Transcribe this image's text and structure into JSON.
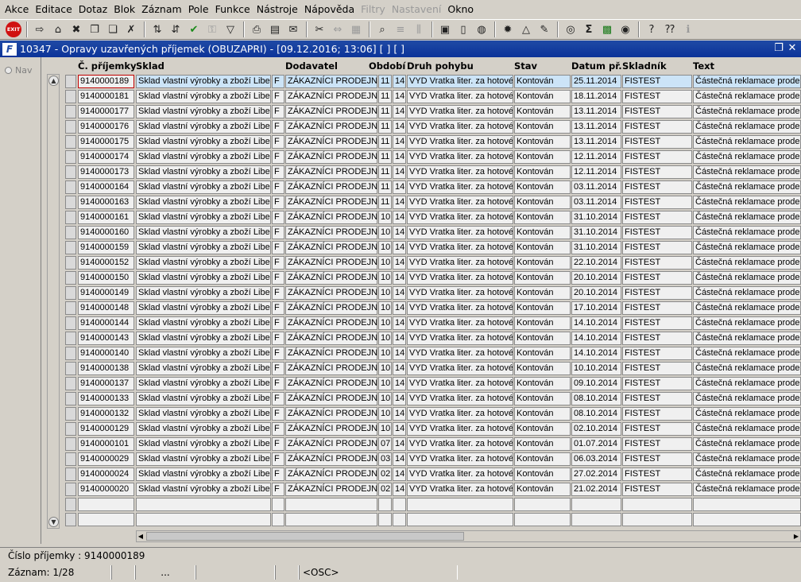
{
  "menu": [
    "Akce",
    "Editace",
    "Dotaz",
    "Blok",
    "Záznam",
    "Pole",
    "Funkce",
    "Nástroje",
    "Nápověda",
    "Filtry",
    "Nastavení",
    "Okno"
  ],
  "menu_disabled": [
    "Filtry",
    "Nastavení"
  ],
  "toolbar": {
    "exit_label": "EXIT",
    "icons": [
      "save-icon",
      "print-icon",
      "delete-icon",
      "copy-icon",
      "paste-icon",
      "clear-icon",
      "sort-asc-icon",
      "sort-desc-icon",
      "check-icon",
      "key-icon",
      "filter-icon",
      "printer-icon",
      "document-icon",
      "mail-icon",
      "cut-icon",
      "move-icon",
      "table-icon",
      "search-icon",
      "list-icon",
      "columns-icon",
      "report-icon",
      "page-icon",
      "globe-icon",
      "gear-icon",
      "triangle-icon",
      "edit-icon",
      "disk-icon",
      "sum-icon",
      "excel-icon",
      "web-icon",
      "help-icon",
      "whatsthis-icon",
      "info-icon"
    ]
  },
  "window": {
    "title": "10347 - Opravy uzavřených příjemek (OBUZAPRI) - [09.12.2016; 13:06] [ ] [ ]",
    "restore_glyph": "❐",
    "close_glyph": "✕"
  },
  "nav": {
    "label": "Nav"
  },
  "columns": {
    "cislo": "Č. příjemky",
    "sklad": "Sklad",
    "dodavatel": "Dodavatel",
    "obdobi": "Období",
    "druh": "Druh pohybu",
    "stav": "Stav",
    "datum": "Datum př.",
    "skladnik": "Skladník",
    "text": "Text"
  },
  "rows": [
    {
      "cislo": "9140000189",
      "sklad": "Sklad vlastní výrobky a zboží Liber",
      "f": "F",
      "dodavatel": "ZÁKAZNÍCI PRODEJNY",
      "o1": "11",
      "o2": "14",
      "druh": "VYD Vratka liter. za hotové",
      "stav": "Kontován",
      "datum": "25.11.2014",
      "skladnik": "FISTEST",
      "text": "Částečná reklamace prode"
    },
    {
      "cislo": "9140000181",
      "sklad": "Sklad vlastní výrobky a zboží Liber",
      "f": "F",
      "dodavatel": "ZÁKAZNÍCI PRODEJNY",
      "o1": "11",
      "o2": "14",
      "druh": "VYD Vratka liter. za hotové",
      "stav": "Kontován",
      "datum": "18.11.2014",
      "skladnik": "FISTEST",
      "text": "Částečná reklamace prode"
    },
    {
      "cislo": "9140000177",
      "sklad": "Sklad vlastní výrobky a zboží Liber",
      "f": "F",
      "dodavatel": "ZÁKAZNÍCI PRODEJNY",
      "o1": "11",
      "o2": "14",
      "druh": "VYD Vratka liter. za hotové",
      "stav": "Kontován",
      "datum": "13.11.2014",
      "skladnik": "FISTEST",
      "text": "Částečná reklamace prode"
    },
    {
      "cislo": "9140000176",
      "sklad": "Sklad vlastní výrobky a zboží Liber",
      "f": "F",
      "dodavatel": "ZÁKAZNÍCI PRODEJNY",
      "o1": "11",
      "o2": "14",
      "druh": "VYD Vratka liter. za hotové",
      "stav": "Kontován",
      "datum": "13.11.2014",
      "skladnik": "FISTEST",
      "text": "Částečná reklamace prode"
    },
    {
      "cislo": "9140000175",
      "sklad": "Sklad vlastní výrobky a zboží Liber",
      "f": "F",
      "dodavatel": "ZÁKAZNÍCI PRODEJNY",
      "o1": "11",
      "o2": "14",
      "druh": "VYD Vratka liter. za hotové",
      "stav": "Kontován",
      "datum": "13.11.2014",
      "skladnik": "FISTEST",
      "text": "Částečná reklamace prode"
    },
    {
      "cislo": "9140000174",
      "sklad": "Sklad vlastní výrobky a zboží Liber",
      "f": "F",
      "dodavatel": "ZÁKAZNÍCI PRODEJNY",
      "o1": "11",
      "o2": "14",
      "druh": "VYD Vratka liter. za hotové",
      "stav": "Kontován",
      "datum": "12.11.2014",
      "skladnik": "FISTEST",
      "text": "Částečná reklamace prode"
    },
    {
      "cislo": "9140000173",
      "sklad": "Sklad vlastní výrobky a zboží Liber",
      "f": "F",
      "dodavatel": "ZÁKAZNÍCI PRODEJNY",
      "o1": "11",
      "o2": "14",
      "druh": "VYD Vratka liter. za hotové",
      "stav": "Kontován",
      "datum": "12.11.2014",
      "skladnik": "FISTEST",
      "text": "Částečná reklamace prode"
    },
    {
      "cislo": "9140000164",
      "sklad": "Sklad vlastní výrobky a zboží Liber",
      "f": "F",
      "dodavatel": "ZÁKAZNÍCI PRODEJNY",
      "o1": "11",
      "o2": "14",
      "druh": "VYD Vratka liter. za hotové",
      "stav": "Kontován",
      "datum": "03.11.2014",
      "skladnik": "FISTEST",
      "text": "Částečná reklamace prode"
    },
    {
      "cislo": "9140000163",
      "sklad": "Sklad vlastní výrobky a zboží Liber",
      "f": "F",
      "dodavatel": "ZÁKAZNÍCI PRODEJNY",
      "o1": "11",
      "o2": "14",
      "druh": "VYD Vratka liter. za hotové",
      "stav": "Kontován",
      "datum": "03.11.2014",
      "skladnik": "FISTEST",
      "text": "Částečná reklamace prode"
    },
    {
      "cislo": "9140000161",
      "sklad": "Sklad vlastní výrobky a zboží Liber",
      "f": "F",
      "dodavatel": "ZÁKAZNÍCI PRODEJNY",
      "o1": "10",
      "o2": "14",
      "druh": "VYD Vratka liter. za hotové",
      "stav": "Kontován",
      "datum": "31.10.2014",
      "skladnik": "FISTEST",
      "text": "Částečná reklamace prode"
    },
    {
      "cislo": "9140000160",
      "sklad": "Sklad vlastní výrobky a zboží Liber",
      "f": "F",
      "dodavatel": "ZÁKAZNÍCI PRODEJNY",
      "o1": "10",
      "o2": "14",
      "druh": "VYD Vratka liter. za hotové",
      "stav": "Kontován",
      "datum": "31.10.2014",
      "skladnik": "FISTEST",
      "text": "Částečná reklamace prode"
    },
    {
      "cislo": "9140000159",
      "sklad": "Sklad vlastní výrobky a zboží Liber",
      "f": "F",
      "dodavatel": "ZÁKAZNÍCI PRODEJNY",
      "o1": "10",
      "o2": "14",
      "druh": "VYD Vratka liter. za hotové",
      "stav": "Kontován",
      "datum": "31.10.2014",
      "skladnik": "FISTEST",
      "text": "Částečná reklamace prode"
    },
    {
      "cislo": "9140000152",
      "sklad": "Sklad vlastní výrobky a zboží Liber",
      "f": "F",
      "dodavatel": "ZÁKAZNÍCI PRODEJNY",
      "o1": "10",
      "o2": "14",
      "druh": "VYD Vratka liter. za hotové",
      "stav": "Kontován",
      "datum": "22.10.2014",
      "skladnik": "FISTEST",
      "text": "Částečná reklamace prode"
    },
    {
      "cislo": "9140000150",
      "sklad": "Sklad vlastní výrobky a zboží Liber",
      "f": "F",
      "dodavatel": "ZÁKAZNÍCI PRODEJNY",
      "o1": "10",
      "o2": "14",
      "druh": "VYD Vratka liter. za hotové",
      "stav": "Kontován",
      "datum": "20.10.2014",
      "skladnik": "FISTEST",
      "text": "Částečná reklamace prode"
    },
    {
      "cislo": "9140000149",
      "sklad": "Sklad vlastní výrobky a zboží Liber",
      "f": "F",
      "dodavatel": "ZÁKAZNÍCI PRODEJNY",
      "o1": "10",
      "o2": "14",
      "druh": "VYD Vratka liter. za hotové",
      "stav": "Kontován",
      "datum": "20.10.2014",
      "skladnik": "FISTEST",
      "text": "Částečná reklamace prode"
    },
    {
      "cislo": "9140000148",
      "sklad": "Sklad vlastní výrobky a zboží Liber",
      "f": "F",
      "dodavatel": "ZÁKAZNÍCI PRODEJNY",
      "o1": "10",
      "o2": "14",
      "druh": "VYD Vratka liter. za hotové",
      "stav": "Kontován",
      "datum": "17.10.2014",
      "skladnik": "FISTEST",
      "text": "Částečná reklamace prode"
    },
    {
      "cislo": "9140000144",
      "sklad": "Sklad vlastní výrobky a zboží Liber",
      "f": "F",
      "dodavatel": "ZÁKAZNÍCI PRODEJNY",
      "o1": "10",
      "o2": "14",
      "druh": "VYD Vratka liter. za hotové",
      "stav": "Kontován",
      "datum": "14.10.2014",
      "skladnik": "FISTEST",
      "text": "Částečná reklamace prode"
    },
    {
      "cislo": "9140000143",
      "sklad": "Sklad vlastní výrobky a zboží Liber",
      "f": "F",
      "dodavatel": "ZÁKAZNÍCI PRODEJNY",
      "o1": "10",
      "o2": "14",
      "druh": "VYD Vratka liter. za hotové",
      "stav": "Kontován",
      "datum": "14.10.2014",
      "skladnik": "FISTEST",
      "text": "Částečná reklamace prode"
    },
    {
      "cislo": "9140000140",
      "sklad": "Sklad vlastní výrobky a zboží Liber",
      "f": "F",
      "dodavatel": "ZÁKAZNÍCI PRODEJNY",
      "o1": "10",
      "o2": "14",
      "druh": "VYD Vratka liter. za hotové",
      "stav": "Kontován",
      "datum": "14.10.2014",
      "skladnik": "FISTEST",
      "text": "Částečná reklamace prode"
    },
    {
      "cislo": "9140000138",
      "sklad": "Sklad vlastní výrobky a zboží Liber",
      "f": "F",
      "dodavatel": "ZÁKAZNÍCI PRODEJNY",
      "o1": "10",
      "o2": "14",
      "druh": "VYD Vratka liter. za hotové",
      "stav": "Kontován",
      "datum": "10.10.2014",
      "skladnik": "FISTEST",
      "text": "Částečná reklamace prode"
    },
    {
      "cislo": "9140000137",
      "sklad": "Sklad vlastní výrobky a zboží Liber",
      "f": "F",
      "dodavatel": "ZÁKAZNÍCI PRODEJNY",
      "o1": "10",
      "o2": "14",
      "druh": "VYD Vratka liter. za hotové",
      "stav": "Kontován",
      "datum": "09.10.2014",
      "skladnik": "FISTEST",
      "text": "Částečná reklamace prode"
    },
    {
      "cislo": "9140000133",
      "sklad": "Sklad vlastní výrobky a zboží Liber",
      "f": "F",
      "dodavatel": "ZÁKAZNÍCI PRODEJNY",
      "o1": "10",
      "o2": "14",
      "druh": "VYD Vratka liter. za hotové",
      "stav": "Kontován",
      "datum": "08.10.2014",
      "skladnik": "FISTEST",
      "text": "Částečná reklamace prode"
    },
    {
      "cislo": "9140000132",
      "sklad": "Sklad vlastní výrobky a zboží Liber",
      "f": "F",
      "dodavatel": "ZÁKAZNÍCI PRODEJNY",
      "o1": "10",
      "o2": "14",
      "druh": "VYD Vratka liter. za hotové",
      "stav": "Kontován",
      "datum": "08.10.2014",
      "skladnik": "FISTEST",
      "text": "Částečná reklamace prode"
    },
    {
      "cislo": "9140000129",
      "sklad": "Sklad vlastní výrobky a zboží Liber",
      "f": "F",
      "dodavatel": "ZÁKAZNÍCI PRODEJNY",
      "o1": "10",
      "o2": "14",
      "druh": "VYD Vratka liter. za hotové",
      "stav": "Kontován",
      "datum": "02.10.2014",
      "skladnik": "FISTEST",
      "text": "Částečná reklamace prode"
    },
    {
      "cislo": "9140000101",
      "sklad": "Sklad vlastní výrobky a zboží Liber",
      "f": "F",
      "dodavatel": "ZÁKAZNÍCI PRODEJNY",
      "o1": "07",
      "o2": "14",
      "druh": "VYD Vratka liter. za hotové",
      "stav": "Kontován",
      "datum": "01.07.2014",
      "skladnik": "FISTEST",
      "text": "Částečná reklamace prode"
    },
    {
      "cislo": "9140000029",
      "sklad": "Sklad vlastní výrobky a zboží Liber",
      "f": "F",
      "dodavatel": "ZÁKAZNÍCI PRODEJNY",
      "o1": "03",
      "o2": "14",
      "druh": "VYD Vratka liter. za hotové",
      "stav": "Kontován",
      "datum": "06.03.2014",
      "skladnik": "FISTEST",
      "text": "Částečná reklamace prode"
    },
    {
      "cislo": "9140000024",
      "sklad": "Sklad vlastní výrobky a zboží Liber",
      "f": "F",
      "dodavatel": "ZÁKAZNÍCI PRODEJNY",
      "o1": "02",
      "o2": "14",
      "druh": "VYD Vratka liter. za hotové",
      "stav": "Kontován",
      "datum": "27.02.2014",
      "skladnik": "FISTEST",
      "text": "Částečná reklamace prode"
    },
    {
      "cislo": "9140000020",
      "sklad": "Sklad vlastní výrobky a zboží Liber",
      "f": "F",
      "dodavatel": "ZÁKAZNÍCI PRODEJNY",
      "o1": "02",
      "o2": "14",
      "druh": "VYD Vratka liter. za hotové",
      "stav": "Kontován",
      "datum": "21.02.2014",
      "skladnik": "FISTEST",
      "text": "Částečná reklamace prode"
    },
    {
      "cislo": "",
      "sklad": "",
      "f": "",
      "dodavatel": "",
      "o1": "",
      "o2": "",
      "druh": "",
      "stav": "",
      "datum": "",
      "skladnik": "",
      "text": ""
    },
    {
      "cislo": "",
      "sklad": "",
      "f": "",
      "dodavatel": "",
      "o1": "",
      "o2": "",
      "druh": "",
      "stav": "",
      "datum": "",
      "skladnik": "",
      "text": ""
    }
  ],
  "status": {
    "field": "Číslo příjemky : 9140000189",
    "record": "Záznam: 1/28",
    "seg_ellipsis": "...",
    "mode": "<OSC>"
  }
}
